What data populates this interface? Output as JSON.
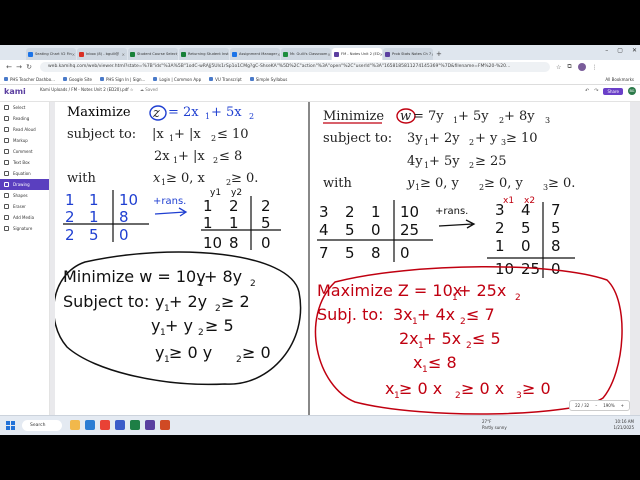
{
  "browser": {
    "tabs": [
      {
        "label": "Seating Chart V2 Fin",
        "color": "#1a73e8",
        "active": false
      },
      {
        "label": "Inbox (8) - bgulli@",
        "color": "#d93025",
        "active": false
      },
      {
        "label": "Student Course Select",
        "color": "#188038",
        "active": false
      },
      {
        "label": "Returning Student Inst",
        "color": "#188038",
        "active": false
      },
      {
        "label": "Assignment Manager",
        "color": "#1a73e8",
        "active": false
      },
      {
        "label": "Mr. Gulli's Classroom",
        "color": "#1e8e3e",
        "active": false
      },
      {
        "label": "FM - Notes Unit 2 (ED",
        "color": "#5b3fa0",
        "active": true
      },
      {
        "label": "Prob Stats Notes Ch 7",
        "color": "#5b3fa0",
        "active": false
      }
    ],
    "newtab": "+",
    "window_controls": [
      "–",
      "▢",
      "✕"
    ],
    "url": "web.kamihq.com/web/viewer.html?state=%7B\"ids\"%3A%5B\"1odC-wRAJj5Uls1rSp1o1CMg?gC-ShseKA\"%5D%2C\"action\"%3A\"open\"%2C\"userId\"%3A\"1658185811274145369\"%7D&filename=FM%20-%20...",
    "bookmarks": [
      "PHS Teacher Dashbo...",
      "Google Site",
      "PHS Sign In | Sign...",
      "Login | Common App",
      "VU Transcript",
      "Simple Syllabus"
    ],
    "all_bookmarks": "All Bookmarks"
  },
  "kami": {
    "logo": "kami",
    "sub": "Kami Uploads",
    "crumb": "Kami Uploads  /  FM - Notes Unit 2 (ED20).pdf  ☆",
    "saved": "☁ Saved",
    "share": "Share",
    "avatar": "BG",
    "notes_heading": "Notes"
  },
  "sidebar": {
    "items": [
      {
        "label": "Select",
        "active": false
      },
      {
        "label": "Reading",
        "active": false
      },
      {
        "label": "Read Aloud",
        "active": false
      },
      {
        "label": "Markup",
        "active": false
      },
      {
        "label": "Comment",
        "active": false
      },
      {
        "label": "Text Box",
        "active": false
      },
      {
        "label": "Equation",
        "active": false
      },
      {
        "label": "Drawing",
        "active": true
      },
      {
        "label": "Shapes",
        "active": false
      },
      {
        "label": "Eraser",
        "active": false
      },
      {
        "label": "Add Media",
        "active": false
      },
      {
        "label": "Signature",
        "active": false
      }
    ]
  },
  "left_problem": {
    "line1a": "Maximize",
    "line1b": "z",
    "line1c": "= 2x",
    "line1d": " + 5x",
    "line2a": "subject to:",
    "line2b": "|x",
    "line2c": " + |x",
    "line2d": " ≤ 10",
    "line3": "2x",
    "line3b": " + |x",
    "line3c": " ≤  8",
    "line4a": "with",
    "line4b": "x",
    "line4c": " ≥ 0,   x",
    "line4d": " ≥ 0.",
    "matrix_rows": [
      [
        "1",
        "1",
        "10"
      ],
      [
        "2",
        "1",
        "8"
      ],
      [
        "2",
        "5",
        "0"
      ]
    ],
    "trans": "+rans.",
    "y_labels": [
      "y1",
      "y2"
    ],
    "trans_rows": [
      [
        "1",
        "2",
        "2"
      ],
      [
        "1",
        "1",
        "5"
      ],
      [
        "10",
        "8",
        "0"
      ]
    ],
    "dual_l1": "Minimize  w = 10y",
    "dual_l1b": " + 8y",
    "dual_l2": "Subject to:",
    "dual_l3": "y",
    "dual_l3b": " + 2y",
    "dual_l3c": " ≥ 2",
    "dual_l4": "y",
    "dual_l4b": " + y",
    "dual_l4c": " ≥ 5",
    "dual_l5": "y",
    "dual_l5b": " ≥ 0   y",
    "dual_l5c": " ≥ 0"
  },
  "right_problem": {
    "line1a": "Minimize",
    "line1b": "w",
    "line1c": " = 7y",
    "line1d": " + 5y",
    "line1e": " + 8y",
    "line2a": "subject to:",
    "line2b": "3y",
    "line2c": " + 2y",
    "line2d": " + y",
    "line2e": "  ≥ 10",
    "line3": "4y",
    "line3b": " + 5y",
    "line3c": "         ≥ 25",
    "line4a": "with",
    "line4b": "y",
    "line4c": " ≥ 0,   y",
    "line4d": " ≥ 0,   y",
    "line4e": " ≥ 0.",
    "matrix_rows": [
      [
        "3",
        "2",
        "1",
        "10"
      ],
      [
        "4",
        "5",
        "0",
        "25"
      ],
      [
        "7",
        "5",
        "8",
        "0"
      ]
    ],
    "trans": "+rans.",
    "x_labels": [
      "x1",
      "x2"
    ],
    "trans_rows": [
      [
        "3",
        "4",
        "7"
      ],
      [
        "2",
        "5",
        "5"
      ],
      [
        "1",
        "0",
        "8"
      ],
      [
        "10",
        "25",
        "0"
      ]
    ],
    "dual_l1": "Maximize  Z = 10x",
    "dual_l1b": " + 25x",
    "dual_l2": "Subj. to:",
    "dual_l2b": "3x",
    "dual_l2c": " + 4x",
    "dual_l2d": " ≤ 7",
    "dual_l3": "2x",
    "dual_l3b": " + 5x",
    "dual_l3c": " ≤ 5",
    "dual_l4": "x",
    "dual_l4b": " ≤ 8",
    "dual_l5": "x",
    "dual_l5b": " ≥ 0  x",
    "dual_l5c": " ≥ 0  x",
    "dual_l5d": " ≥ 0"
  },
  "page_controls": {
    "page": "22 / 32",
    "minus": "–",
    "zoom": "190%",
    "plus": "+"
  },
  "taskbar": {
    "search": "Search",
    "weather_temp": "27°F",
    "weather_desc": "Partly sunny",
    "time": "10:16 AM",
    "date": "1/21/2025"
  },
  "colors": {
    "ink_blue": "#1f3fd1",
    "ink_black": "#111111",
    "ink_red": "#c00010",
    "kami_purple": "#5a3fbf"
  }
}
